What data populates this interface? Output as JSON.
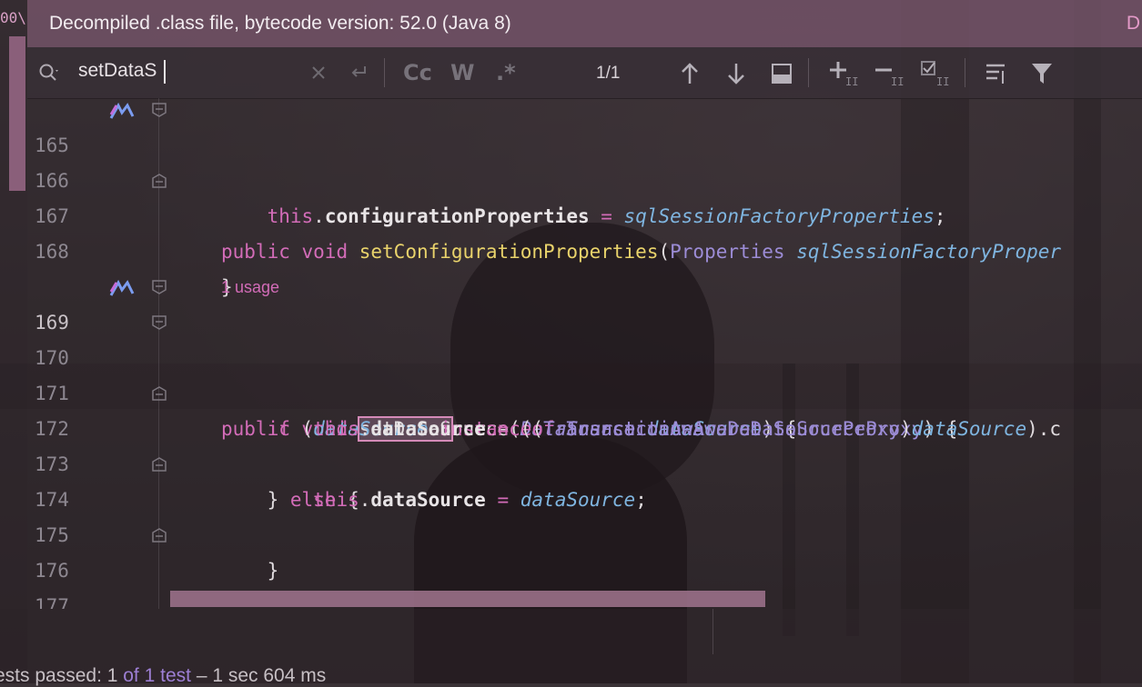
{
  "left_strip": {
    "label": "00\\"
  },
  "banner": {
    "text": "Decompiled .class file, bytecode version: 52.0 (Java 8)",
    "right_text": "D"
  },
  "search": {
    "query": "setDataS",
    "match_count": "1/1",
    "tools": {
      "case": "Cc",
      "words": "W",
      "regex": ".*"
    }
  },
  "editor": {
    "usage_hint": "1 usage",
    "lines": {
      "l165": {
        "num": "165",
        "kw1": "public",
        "kw2": "void",
        "name": "setConfigurationProperties",
        "open": "(",
        "type": "Properties",
        "param": "sqlSessionFactoryProper"
      },
      "l166": {
        "num": "166",
        "this": "this",
        "dot": ".",
        "field": "configurationProperties",
        "eq": " = ",
        "val": "sqlSessionFactoryProperties",
        "end": ";"
      },
      "l167": {
        "num": "167",
        "brace": "}"
      },
      "l168": {
        "num": "168"
      },
      "l169": {
        "num": "169",
        "kw1": "public",
        "kw2": "void",
        "match": "setDataS",
        "rest": "ource",
        "open": "(",
        "type": "DataSource",
        "param": "dataSource",
        "close": ") {"
      },
      "l170": {
        "num": "170",
        "kw": "if",
        "open": " (",
        "var": "dataSource",
        "instanceof": "instanceof",
        "type": "TransactionAwareDataSourceProxy",
        "close": ") {"
      },
      "l171": {
        "num": "171",
        "this": "this",
        "dot": ".",
        "field": "dataSource",
        "eq": " = ",
        "cast_open": "((",
        "type": "TransactionAwareDataSourceProxy",
        "cast_close": ")",
        "var": "dataSource",
        "tail": ").c"
      },
      "l172": {
        "num": "172",
        "brace": "} ",
        "else": "else",
        "open": " {"
      },
      "l173": {
        "num": "173",
        "this": "this",
        "dot": ".",
        "field": "dataSource",
        "eq": " = ",
        "var": "dataSource",
        "end": ";"
      },
      "l174": {
        "num": "174",
        "brace": "}"
      },
      "l175": {
        "num": "175"
      },
      "l176": {
        "num": "176",
        "brace": "}"
      },
      "l177": {
        "num": "177"
      }
    }
  },
  "status": {
    "pre": "ests passed: ",
    "num1": "1",
    "mid": " of ",
    "num2": "1 test",
    "post": " – 1 sec 604 ms"
  }
}
